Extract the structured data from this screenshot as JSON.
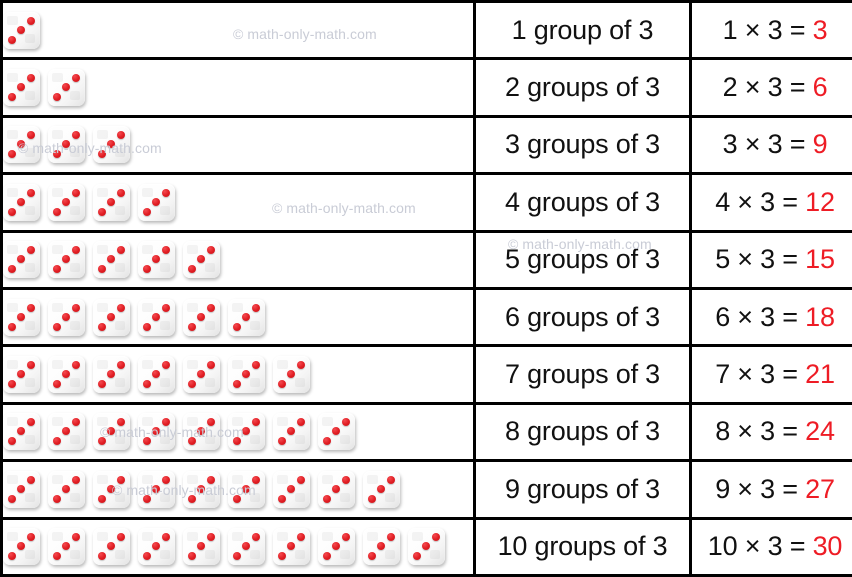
{
  "table": {
    "columns": [
      "dice-groups",
      "groups-description",
      "multiplication-equation"
    ],
    "rows": [
      {
        "dice_count": 1,
        "groups_text": "1 group of 3",
        "eq_left": "1 × 3 = ",
        "eq_answer": "3"
      },
      {
        "dice_count": 2,
        "groups_text": "2 groups of 3",
        "eq_left": "2 × 3 = ",
        "eq_answer": "6"
      },
      {
        "dice_count": 3,
        "groups_text": "3 groups of 3",
        "eq_left": "3 × 3 = ",
        "eq_answer": "9"
      },
      {
        "dice_count": 4,
        "groups_text": "4 groups of 3",
        "eq_left": "4 × 3 = ",
        "eq_answer": "12"
      },
      {
        "dice_count": 5,
        "groups_text": "5 groups of 3",
        "eq_left": "5 × 3 = ",
        "eq_answer": "15"
      },
      {
        "dice_count": 6,
        "groups_text": "6 groups of 3",
        "eq_left": "6 × 3 = ",
        "eq_answer": "18"
      },
      {
        "dice_count": 7,
        "groups_text": "7 groups of 3",
        "eq_left": "7 × 3 = ",
        "eq_answer": "21"
      },
      {
        "dice_count": 8,
        "groups_text": "8 groups of 3",
        "eq_left": "8 × 3 = ",
        "eq_answer": "24"
      },
      {
        "dice_count": 9,
        "groups_text": "9 groups of 3",
        "eq_left": "9 × 3 = ",
        "eq_answer": "27"
      },
      {
        "dice_count": 10,
        "groups_text": "10 groups of 3",
        "eq_left": "10 × 3 = ",
        "eq_answer": "30"
      }
    ]
  },
  "die": {
    "pips": 3,
    "pip_positions": [
      "top-right",
      "center",
      "bottom-left"
    ],
    "pip_color": "#e01c22",
    "face_color": "#fdfdfd"
  },
  "watermarks": [
    {
      "id": "wm-1",
      "text": "© math-only-math.com"
    },
    {
      "id": "wm-3",
      "text": "© math-only-math.com"
    },
    {
      "id": "wm-4",
      "text": "© math-only-math.com"
    },
    {
      "id": "wm-5",
      "text": "© math-only-math.com"
    },
    {
      "id": "wm-8",
      "text": "© math-only-math.com"
    },
    {
      "id": "wm-9",
      "text": "© math-only-math.com"
    }
  ],
  "colors": {
    "answer_red": "#ee1c25",
    "border": "#000000",
    "watermark": "#c9ccd6",
    "text": "#111111"
  }
}
